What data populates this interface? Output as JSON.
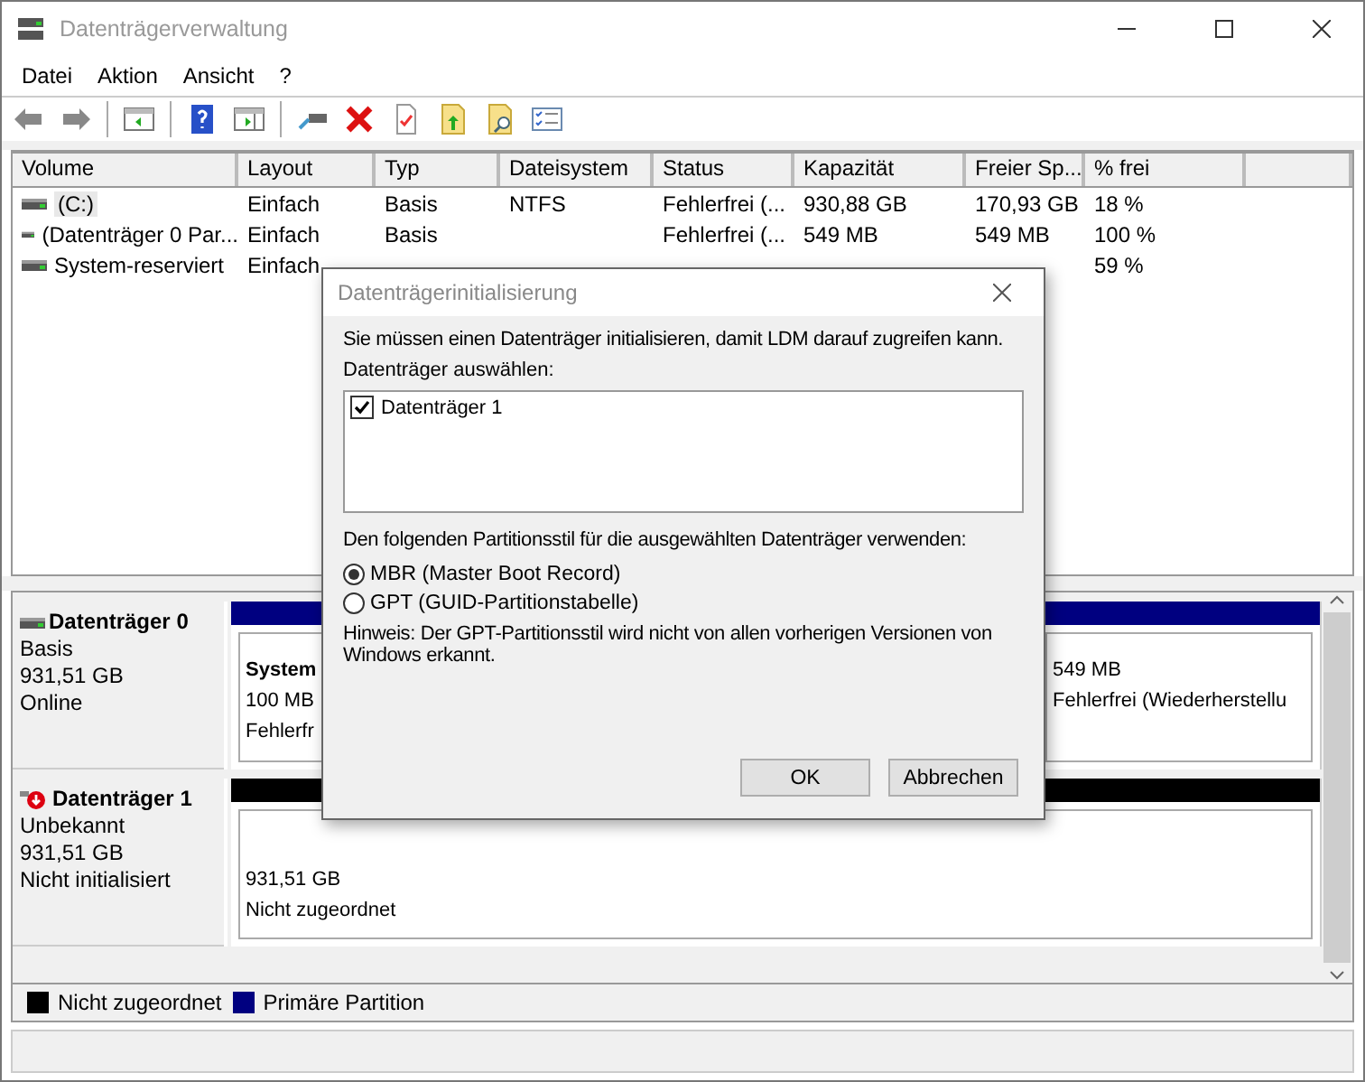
{
  "window": {
    "title": "Datenträgerverwaltung"
  },
  "menu": [
    "Datei",
    "Aktion",
    "Ansicht",
    "?"
  ],
  "table": {
    "columns": [
      "Volume",
      "Layout",
      "Typ",
      "Dateisystem",
      "Status",
      "Kapazität",
      "Freier Sp...",
      "% frei"
    ],
    "rows": [
      {
        "volume": "(C:)",
        "layout": "Einfach",
        "typ": "Basis",
        "dateisystem": "NTFS",
        "status": "Fehlerfrei (...",
        "kapazitaet": "930,88 GB",
        "freier_sp": "170,93 GB",
        "prozent_frei": "18 %",
        "selected": true
      },
      {
        "volume": "(Datenträger 0 Par...",
        "layout": "Einfach",
        "typ": "Basis",
        "status": "Fehlerfrei (...",
        "kapazitaet": "549 MB",
        "freier_sp": "549 MB",
        "prozent_frei": "100 %",
        "selected": false
      },
      {
        "volume": "System-reserviert",
        "layout": "Einfach",
        "prozent_frei": "59 %",
        "selected": false
      }
    ]
  },
  "disks": [
    {
      "name": "Datenträger 0",
      "type": "Basis",
      "size": "931,51 GB",
      "status": "Online",
      "warning": false,
      "partitions": [
        {
          "kind": "primary",
          "lines": [
            "System",
            "100 MB",
            "Fehlerfr"
          ],
          "bold_first": true
        },
        {
          "kind": "primary",
          "lines": [
            "549 MB",
            "Fehlerfrei (Wiederherstellu"
          ],
          "bold_first": false
        }
      ]
    },
    {
      "name": "Datenträger 1",
      "type": "Unbekannt",
      "size": "931,51 GB",
      "status": "Nicht initialisiert",
      "warning": true,
      "partitions": [
        {
          "kind": "unallocated",
          "lines": [
            "931,51 GB",
            "Nicht zugeordnet"
          ],
          "bold_first": false
        }
      ]
    }
  ],
  "legend": [
    {
      "label": "Nicht zugeordnet",
      "color": "#000000"
    },
    {
      "label": "Primäre Partition",
      "color": "#000080"
    }
  ],
  "dialog": {
    "title": "Datenträgerinitialisierung",
    "intro": "Sie müssen einen Datenträger initialisieren, damit LDM darauf zugreifen kann.",
    "select_label": "Datenträger auswählen:",
    "disks": [
      {
        "label": "Datenträger 1",
        "checked": true
      }
    ],
    "style_label": "Den folgenden Partitionsstil für die ausgewählten Datenträger verwenden:",
    "styles": [
      {
        "label": "MBR (Master Boot Record)",
        "selected": true
      },
      {
        "label": "GPT (GUID-Partitionstabelle)",
        "selected": false
      }
    ],
    "note": "Hinweis: Der GPT-Partitionsstil wird nicht von allen vorherigen Versionen von Windows erkannt.",
    "buttons": [
      "OK",
      "Abbrechen"
    ]
  }
}
